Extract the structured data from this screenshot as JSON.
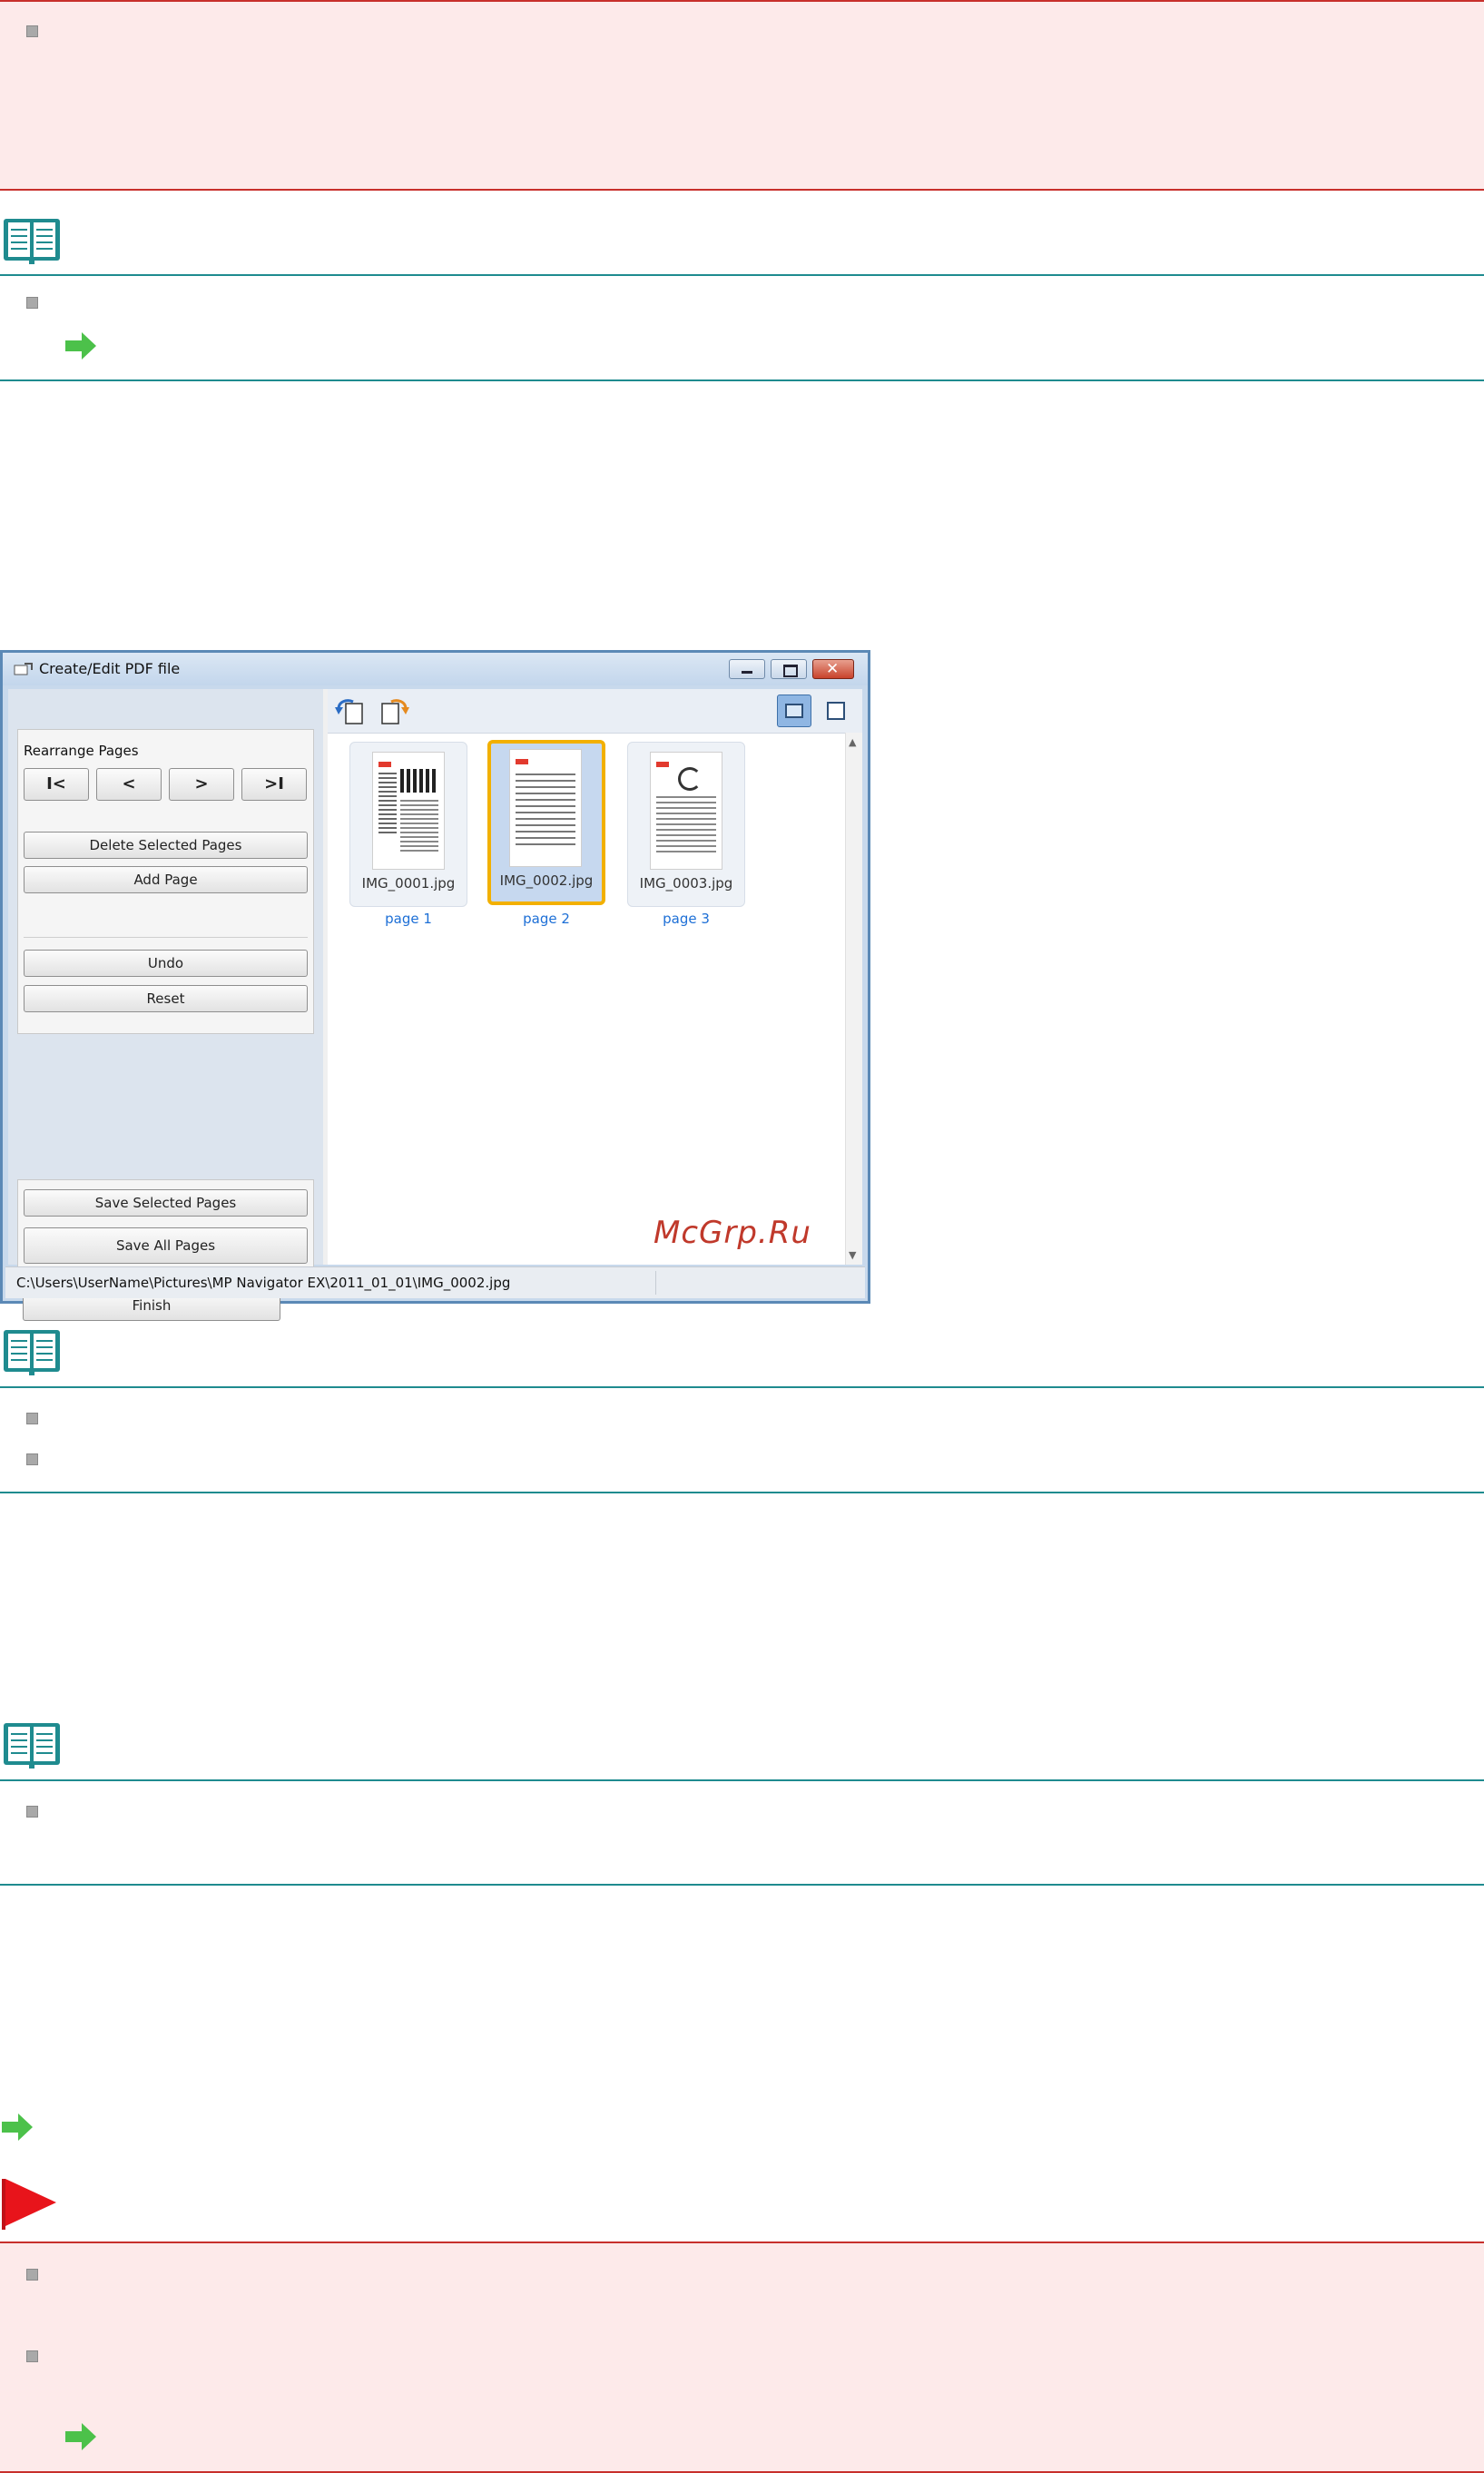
{
  "window": {
    "title": "Create/Edit PDF file",
    "rearrange_label": "Rearrange Pages",
    "nav_buttons": [
      "I<",
      "<",
      ">",
      ">I"
    ],
    "delete_selected_label": "Delete Selected Pages",
    "add_page_label": "Add Page",
    "undo_label": "Undo",
    "reset_label": "Reset",
    "save_selected_label": "Save Selected Pages",
    "save_all_label": "Save All Pages",
    "finish_label": "Finish",
    "thumbnails": [
      {
        "file": "IMG_0001.jpg",
        "page": "page 1",
        "selected": false
      },
      {
        "file": "IMG_0002.jpg",
        "page": "page 2",
        "selected": true
      },
      {
        "file": "IMG_0003.jpg",
        "page": "page 3",
        "selected": false
      }
    ],
    "status_path": "C:\\Users\\UserName\\Pictures\\MP Navigator EX\\2011_01_01\\IMG_0002.jpg"
  },
  "watermark": "McGrp.Ru",
  "colors": {
    "important_border": "#c8302c",
    "important_bg": "#fdeaea",
    "note_line": "#1f8b8f",
    "link_arrow": "#4cc14a",
    "flag": "#e8141b",
    "selection": "#f2b000"
  },
  "icons": [
    "note-book-icon",
    "link-arrow-icon",
    "important-flag-icon",
    "bullet-icon",
    "rotate-left-icon",
    "rotate-right-icon",
    "thumbnail-view-icon",
    "single-page-view-icon",
    "minimize-icon",
    "maximize-icon",
    "close-icon"
  ]
}
